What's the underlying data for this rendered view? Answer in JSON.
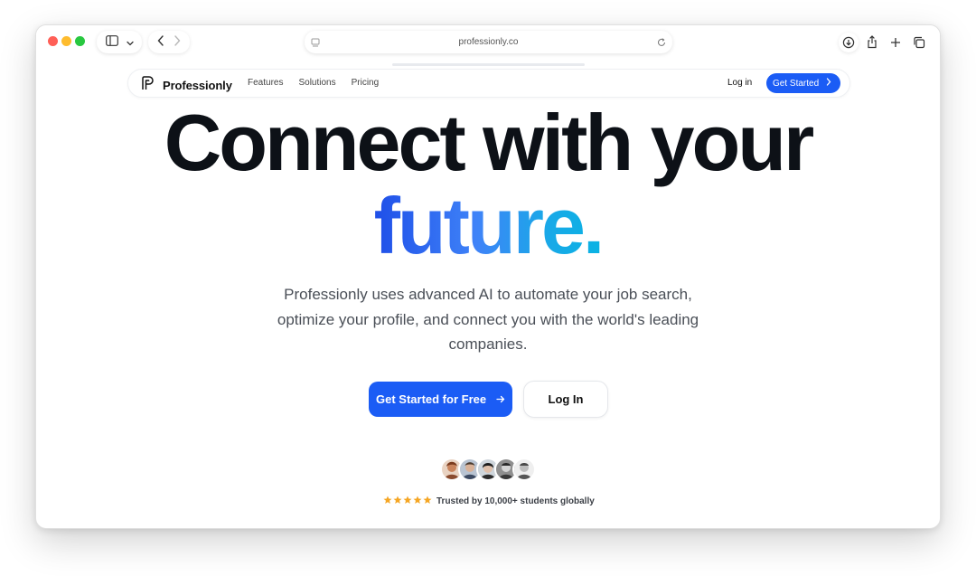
{
  "browser": {
    "url": "professionly.co"
  },
  "site": {
    "brand": "Professionly",
    "nav_links": [
      "Features",
      "Solutions",
      "Pricing"
    ],
    "login_label": "Log in",
    "cta_label": "Get Started"
  },
  "hero": {
    "headline_line1": "Connect with your",
    "headline_line2": "future.",
    "subtitle": "Professionly uses advanced AI to automate your job search, optimize your profile, and connect you with the world's leading companies.",
    "primary_button": "Get Started for Free",
    "secondary_button": "Log In",
    "rating_stars": 5,
    "trust_text": "Trusted by 10,000+ students globally"
  },
  "colors": {
    "accent": "#1b5cf5",
    "headline": "#0d1117",
    "star": "#f5a623"
  },
  "icons": {
    "sidebar": "sidebar-icon",
    "chevron": "chevron-down-icon",
    "back": "back-arrow-icon",
    "forward": "forward-arrow-icon",
    "reload": "reload-icon",
    "download": "download-icon",
    "share": "share-icon",
    "new_tab": "plus-icon",
    "tabs": "tabs-overview-icon"
  }
}
